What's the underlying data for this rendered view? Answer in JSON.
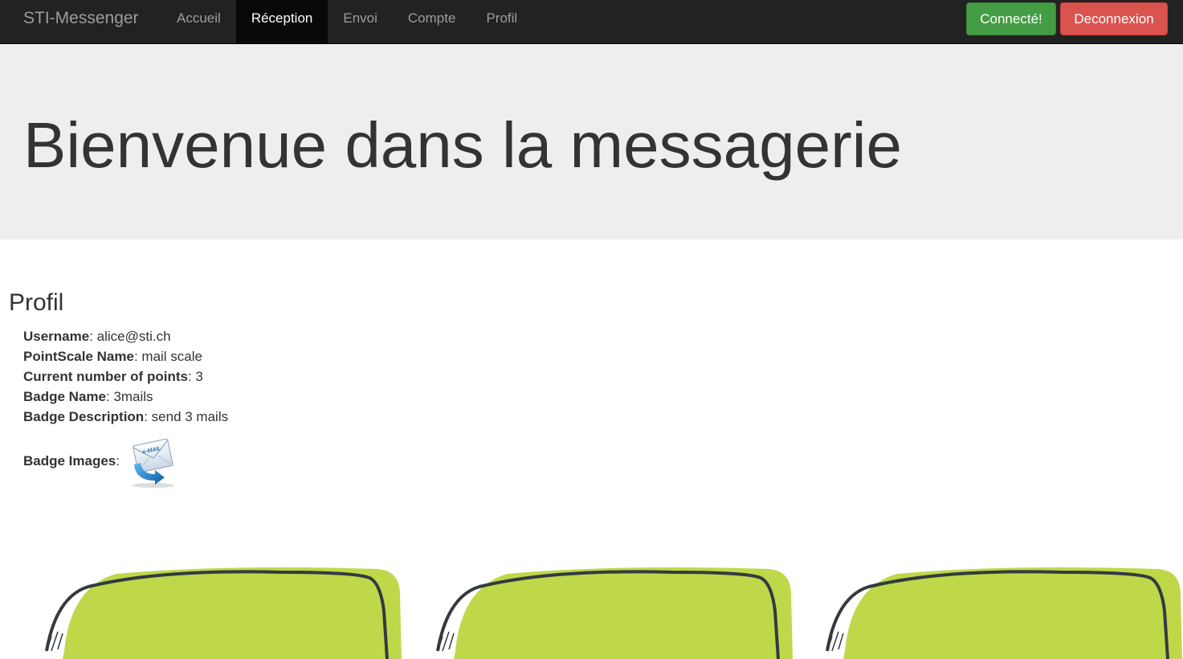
{
  "navbar": {
    "brand": "STI-Messenger",
    "items": [
      {
        "label": "Accueil",
        "active": false
      },
      {
        "label": "Réception",
        "active": true
      },
      {
        "label": "Envoi",
        "active": false
      },
      {
        "label": "Compte",
        "active": false
      },
      {
        "label": "Profil",
        "active": false
      }
    ],
    "connected_label": "Connecté!",
    "logout_label": "Deconnexion"
  },
  "jumbotron": {
    "title": "Bienvenue dans la messagerie"
  },
  "profile": {
    "title": "Profil",
    "fields": [
      {
        "label": "Username",
        "value": "alice@sti.ch"
      },
      {
        "label": "PointScale Name",
        "value": "mail scale"
      },
      {
        "label": "Current number of points",
        "value": "3"
      },
      {
        "label": "Badge Name",
        "value": "3mails"
      },
      {
        "label": "Badge Description",
        "value": "send 3 mails"
      }
    ],
    "badge_images_label": "Badge Images",
    "badge_icon": "email-envelope-icon",
    "badge_icon_text": "e-MAIL"
  },
  "colors": {
    "navbar_bg": "#222222",
    "success": "#449d44",
    "danger": "#d9534f",
    "jumbotron_bg": "#eeeeee",
    "card_green": "#bed849",
    "card_outline": "#333a40"
  }
}
